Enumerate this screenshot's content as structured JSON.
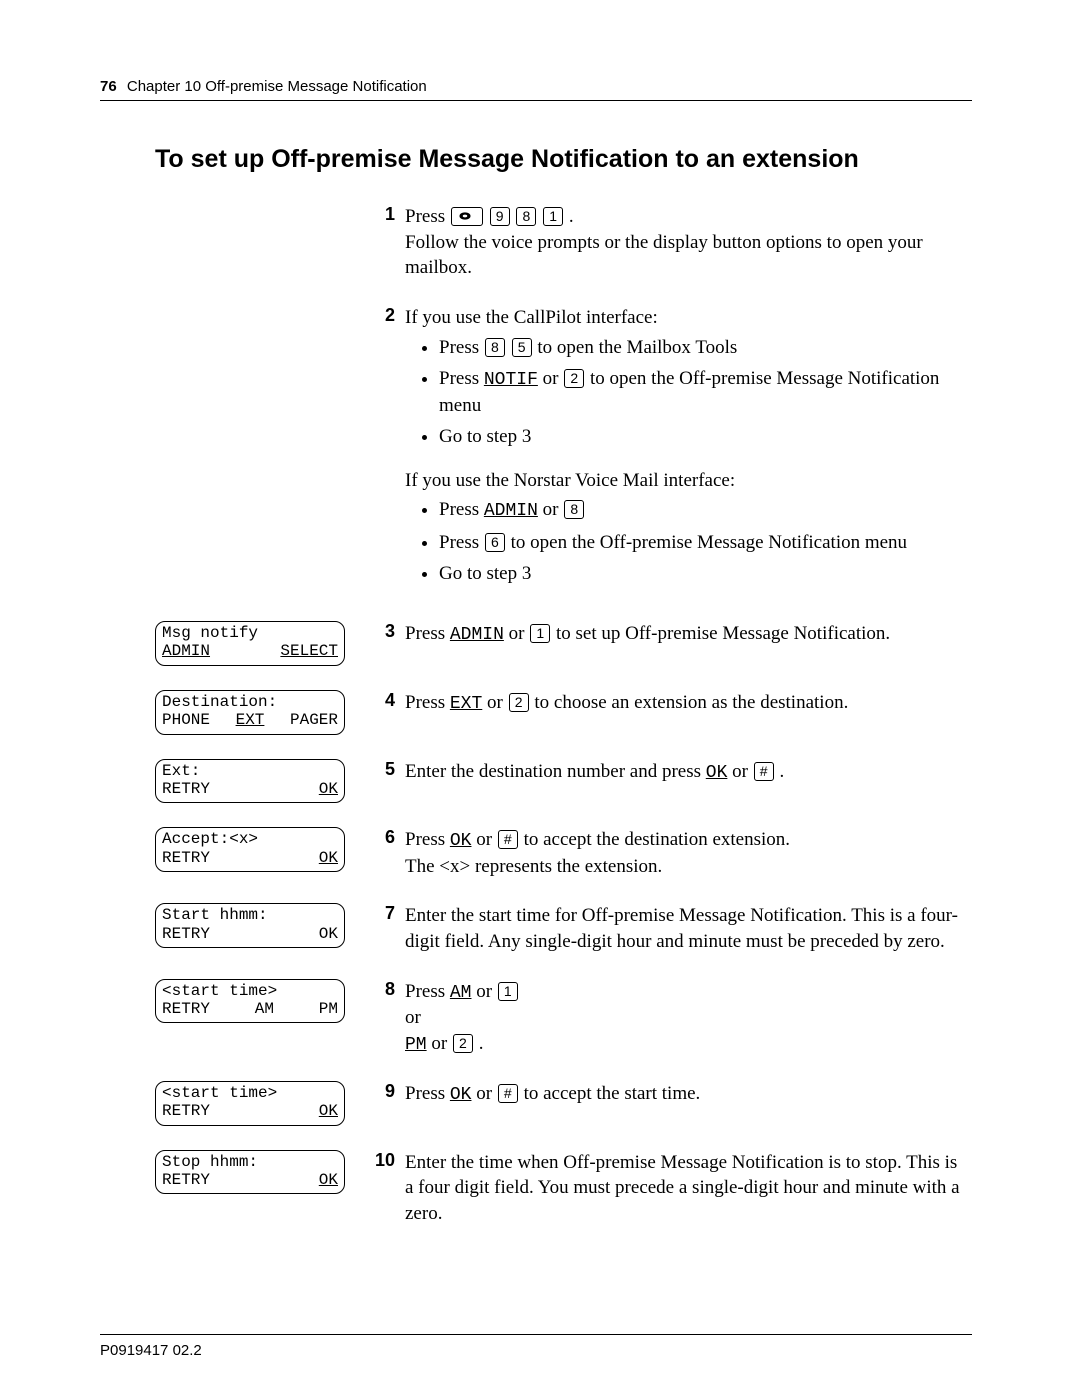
{
  "header": {
    "page_number": "76",
    "chapter": "Chapter 10  Off-premise Message Notification"
  },
  "title": "To set up Off-premise Message Notification to an extension",
  "footer": {
    "docid": "P0919417 02.2"
  },
  "keys": {
    "k9": "9",
    "k8": "8",
    "k1": "1",
    "k5": "5",
    "k2": "2",
    "k6": "6",
    "khash": "#"
  },
  "softkeys": {
    "notif": "NOTIF",
    "admin": "ADMIN",
    "ext": "EXT",
    "ok": "OK",
    "am": "AM",
    "pm": "PM"
  },
  "steps": {
    "s1": {
      "num": "1",
      "a": "Press ",
      "b": " .",
      "c": "Follow the voice prompts or the display button options to open your mailbox."
    },
    "s2": {
      "num": "2",
      "intro_cp": "If you use the CallPilot interface:",
      "cp1a": "Press ",
      "cp1b": " to open the Mailbox Tools",
      "cp2a": "Press ",
      "cp2b": " or ",
      "cp2c": " to open the Off-premise Message Notification menu",
      "cp3": "Go to step 3",
      "intro_nv": "If you use the Norstar Voice Mail interface:",
      "nv1a": "Press ",
      "nv1b": " or ",
      "nv2a": "Press ",
      "nv2b": " to open the Off-premise Message Notification menu",
      "nv3": "Go to step 3"
    },
    "s3": {
      "num": "3",
      "a": "Press ",
      "b": " or ",
      "c": " to set up Off-premise Message Notification.",
      "lcd": {
        "l1": "Msg notify",
        "left": "ADMIN",
        "right": "SELECT"
      }
    },
    "s4": {
      "num": "4",
      "a": "Press ",
      "b": " or ",
      "c": " to choose an extension as the destination.",
      "lcd": {
        "l1": "Destination:",
        "left": "PHONE",
        "mid": "EXT",
        "right": "PAGER"
      }
    },
    "s5": {
      "num": "5",
      "a": "Enter the destination number and press ",
      "b": " or ",
      "c": " .",
      "lcd": {
        "l1": "Ext:",
        "left": "RETRY",
        "right": "OK"
      }
    },
    "s6": {
      "num": "6",
      "a": "Press ",
      "b": " or ",
      "c": " to accept the destination extension.",
      "d": "The <x> represents the extension.",
      "lcd": {
        "l1": "Accept:<x>",
        "left": "RETRY",
        "right": "OK"
      }
    },
    "s7": {
      "num": "7",
      "text": "Enter the start time for Off-premise Message Notification. This is a four-digit field. Any single-digit hour and minute must be preceded by zero.",
      "lcd": {
        "l1": "Start hhmm:",
        "left": "RETRY",
        "right": "OK"
      }
    },
    "s8": {
      "num": "8",
      "a": "Press ",
      "b": " or ",
      "or": "or",
      "c": " or ",
      "d": " .",
      "lcd": {
        "l1": "<start time>",
        "left": "RETRY",
        "mid": "AM",
        "right": "PM"
      }
    },
    "s9": {
      "num": "9",
      "a": "Press ",
      "b": " or ",
      "c": " to accept the start time.",
      "lcd": {
        "l1": "<start time>",
        "left": "RETRY",
        "right": "OK"
      }
    },
    "s10": {
      "num": "10",
      "text": "Enter the time when Off-premise Message Notification is to stop. This is a four digit field. You must precede a single-digit hour and minute with a zero.",
      "lcd": {
        "l1": "Stop hhmm:",
        "left": "RETRY",
        "right": "OK"
      }
    }
  }
}
